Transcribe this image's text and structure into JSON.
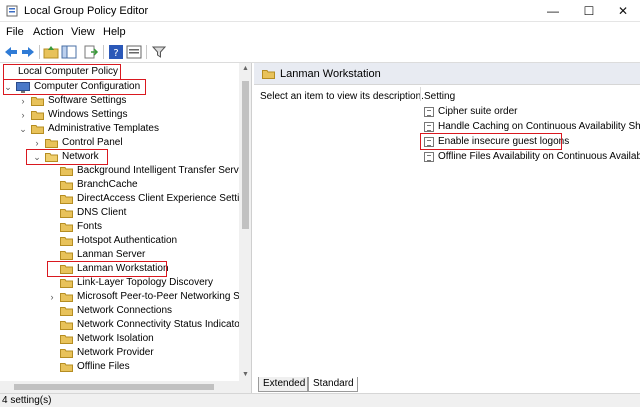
{
  "window": {
    "title": "Local Group Policy Editor",
    "controls": {
      "minimize": "—",
      "maximize": "☐",
      "close": "✕"
    }
  },
  "menu": [
    "File",
    "Action",
    "View",
    "Help"
  ],
  "toolbar_icons": [
    "back-icon",
    "forward-icon",
    "up-folder-icon",
    "show-hide-tree-icon",
    "export-list-icon",
    "help-icon",
    "properties-icon",
    "filter-icon"
  ],
  "tree": {
    "root": "Local Computer Policy",
    "computer_configuration": "Computer Configuration",
    "software_settings": "Software Settings",
    "windows_settings": "Windows Settings",
    "administrative_templates": "Administrative Templates",
    "control_panel": "Control Panel",
    "network": "Network",
    "network_children": [
      "Background Intelligent Transfer Service",
      "BranchCache",
      "DirectAccess Client Experience Settings",
      "DNS Client",
      "Fonts",
      "Hotspot Authentication",
      "Lanman Server",
      "Lanman Workstation",
      "Link-Layer Topology Discovery",
      "Microsoft Peer-to-Peer Networking Serv",
      "Network Connections",
      "Network Connectivity Status Indicator",
      "Network Isolation",
      "Network Provider",
      "Offline Files"
    ]
  },
  "right": {
    "header": "Lanman Workstation",
    "description": "Select an item to view its description.",
    "column": "Setting",
    "settings": [
      "Cipher suite order",
      "Handle Caching on Continuous Availability Share",
      "Enable insecure guest logons",
      "Offline Files Availability on Continuous Availabilit"
    ],
    "tabs": [
      "Extended",
      "Standard"
    ]
  },
  "status": "4 setting(s)",
  "colors": {
    "highlight": "#d9181f",
    "folder": "#e8c25a",
    "header": "#e8ebf2"
  }
}
